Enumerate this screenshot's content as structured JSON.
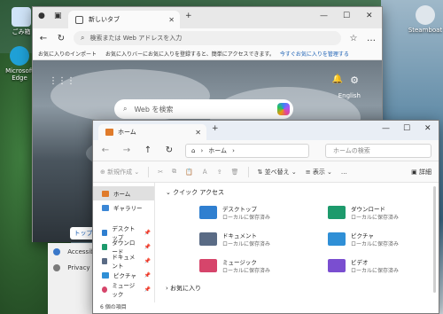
{
  "desktop": {
    "icons": [
      {
        "label": "ごみ箱",
        "color": "#cfe3f7"
      },
      {
        "label": "Microsoft Edge",
        "color": "#1fa0d6"
      }
    ],
    "right_icon": {
      "label": "Steamboat",
      "color": "#dfe6ec"
    }
  },
  "edge": {
    "tab_title": "新しいタブ",
    "address_placeholder": "検索または Web アドレスを入力",
    "favorites_text": "お気に入りのインポート",
    "favorites_hint": "お気に入りバーにお気に入りを登録すると、簡単にアクセスできます。",
    "favorites_link": "今すぐお気に入りを管理する",
    "search_placeholder": "Web を検索",
    "language": "English",
    "top_button": "トップ"
  },
  "settings": {
    "items": [
      {
        "label": "Accessib",
        "color": "#3a78c9"
      },
      {
        "label": "Privacy &",
        "color": "#7a7a7a"
      }
    ]
  },
  "explorer": {
    "tab_title": "ホーム",
    "breadcrumb": "ホーム",
    "search_placeholder": "ホームの検索",
    "toolbar": {
      "new": "新規作成",
      "sort": "並べ替え",
      "view": "表示",
      "more": "…",
      "details": "詳細"
    },
    "sidebar": [
      {
        "label": "ホーム",
        "color": "#e07b2b",
        "active": true,
        "pin": false
      },
      {
        "label": "ギャラリー",
        "color": "#3b87d6",
        "active": false,
        "pin": false
      },
      {
        "label": "デスクトップ",
        "color": "#2f7fd0",
        "active": false,
        "pin": true
      },
      {
        "label": "ダウンロード",
        "color": "#1d9a6c",
        "active": false,
        "pin": true
      },
      {
        "label": "ドキュメント",
        "color": "#5a6b85",
        "active": false,
        "pin": true
      },
      {
        "label": "ピクチャ",
        "color": "#2f8fd6",
        "active": false,
        "pin": true
      },
      {
        "label": "ミュージック",
        "color": "#d6456b",
        "active": false,
        "pin": true
      }
    ],
    "quick_access_header": "クイック アクセス",
    "favorites_header": "お気に入り",
    "folders": [
      {
        "name": "デスクトップ",
        "sub": "ローカルに保存済み",
        "color": "#2f7fd0"
      },
      {
        "name": "ダウンロード",
        "sub": "ローカルに保存済み",
        "color": "#1d9a6c"
      },
      {
        "name": "ドキュメント",
        "sub": "ローカルに保存済み",
        "color": "#5a6b85"
      },
      {
        "name": "ピクチャ",
        "sub": "ローカルに保存済み",
        "color": "#2f8fd6"
      },
      {
        "name": "ミュージック",
        "sub": "ローカルに保存済み",
        "color": "#d6456b"
      },
      {
        "name": "ビデオ",
        "sub": "ローカルに保存済み",
        "color": "#7a4ed0"
      }
    ],
    "status": "6 個の項目"
  }
}
